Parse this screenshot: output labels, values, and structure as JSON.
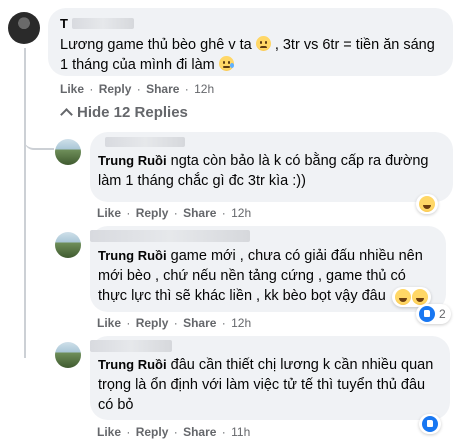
{
  "comment_main": {
    "author": "T",
    "text": "Lương game thủ bèo ghê v ta",
    "text2": ", 3tr vs 6tr = tiền ăn sáng 1 tháng của mình đi làm",
    "actions": {
      "like": "Like",
      "reply": "Reply",
      "share": "Share",
      "time": "12h",
      "dot": "·"
    }
  },
  "toggle": {
    "label": "Hide 12 Replies"
  },
  "replies": [
    {
      "author": "Trung Ruồi",
      "text": "ngta còn bảo là k có bằng cấp ra đường làm 1 tháng chắc gì đc 3tr kìa :))",
      "time": "12h",
      "reaction_count": ""
    },
    {
      "author": "Trung Ruồi",
      "text": "game mới , chưa có giải đấu nhiều nên mới bèo , chứ nếu nền tảng cứng , game thủ có thực lực thì sẽ khác liền , kk bèo bọt vậy đâu",
      "time": "12h",
      "reaction_count": "2"
    },
    {
      "author": "Trung Ruồi",
      "text": "đâu cần thiết chị lương k cần nhiều quan trọng là ổn định với làm việc tử tế thì tuyển thủ đâu có bỏ",
      "time": "11h",
      "reaction_count": ""
    }
  ],
  "labels": {
    "like": "Like",
    "reply": "Reply",
    "share": "Share",
    "dot": "·"
  },
  "colors": {
    "bubble": "#f0f2f5",
    "meta": "#65676b",
    "like_blue": "#1877f2"
  },
  "icons": [
    "sad-emoji-icon",
    "crying-emoji-icon",
    "laugh-reaction-icon",
    "like-reaction-icon",
    "chevron-up-icon"
  ]
}
